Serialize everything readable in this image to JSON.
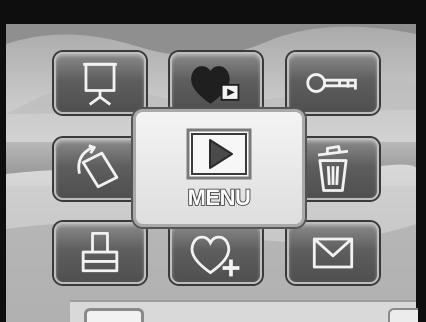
{
  "menu": {
    "center_label": "MENU"
  },
  "icons": {
    "slideshow": "slideshow-icon",
    "favorites_play": "favorites-play-icon",
    "protect": "key-icon",
    "rotate": "rotate-icon",
    "delete": "trash-icon",
    "print": "print-icon",
    "add_favorite": "heart-plus-icon",
    "email": "envelope-icon",
    "play": "play-icon"
  },
  "colors": {
    "tile_fill": "#5e5e5e",
    "tile_border": "#bdbdbd",
    "center_fill": "#e9e9e9"
  }
}
